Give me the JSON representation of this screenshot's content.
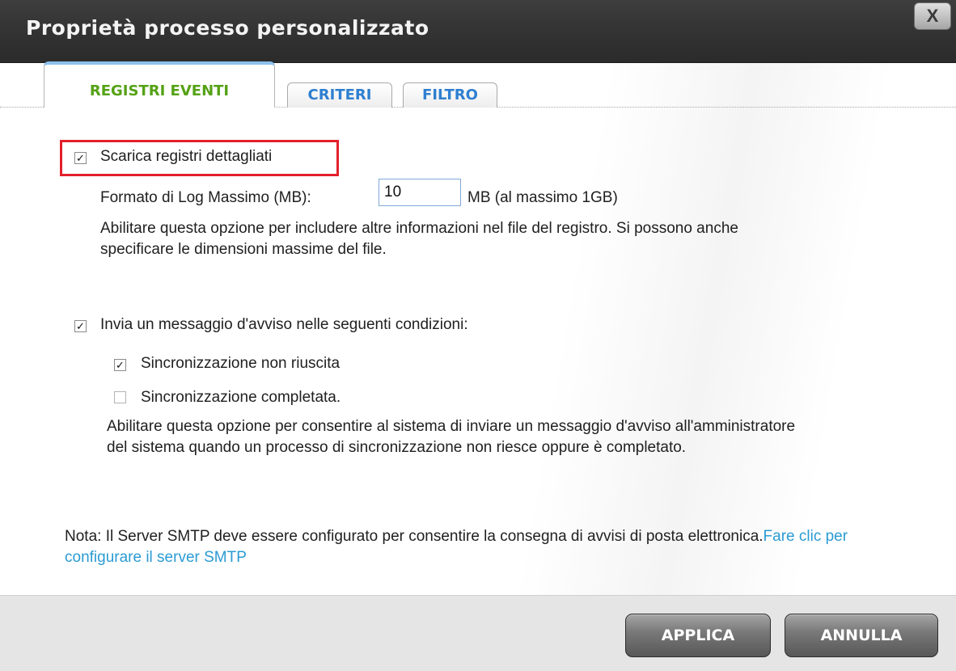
{
  "dialog": {
    "title": "Proprietà processo personalizzato",
    "close_label": "X"
  },
  "tabs": [
    {
      "label": "REGISTRI EVENTI",
      "active": true
    },
    {
      "label": "CRITERI",
      "active": false
    },
    {
      "label": "FILTRO",
      "active": false
    }
  ],
  "event_logs": {
    "detailed_logs": {
      "label": "Scarica registri dettagliati",
      "checked": true
    },
    "max_log_size": {
      "label": "Formato di Log Massimo (MB):",
      "value": "10",
      "unit": "MB (al massimo 1GB)"
    },
    "detailed_logs_description": "Abilitare questa opzione per includere altre informazioni nel file del registro. Si possono anche specificare le dimensioni massime del file.",
    "send_alert": {
      "label": "Invia un messaggio d'avviso nelle seguenti condizioni:",
      "checked": true
    },
    "conditions": [
      {
        "label": "Sincronizzazione non riuscita",
        "checked": true
      },
      {
        "label": "Sincronizzazione completata.",
        "checked": false
      }
    ],
    "alert_description": "Abilitare questa opzione per consentire al sistema di inviare un messaggio d'avviso all'amministratore del sistema quando un processo di sincronizzazione non riesce oppure è completato.",
    "note_text": "Nota: Il Server SMTP deve essere configurato per consentire la consegna di avvisi di posta elettronica.",
    "note_link": "Fare clic per configurare il server SMTP"
  },
  "footer": {
    "apply_label": "APPLICA",
    "cancel_label": "ANNULLA"
  },
  "colors": {
    "titlebar": "#343434",
    "active_tab_text": "#55a215",
    "inactive_tab_text": "#2e7fd0",
    "highlight_border": "#e2202b",
    "link": "#2b9bd3"
  }
}
